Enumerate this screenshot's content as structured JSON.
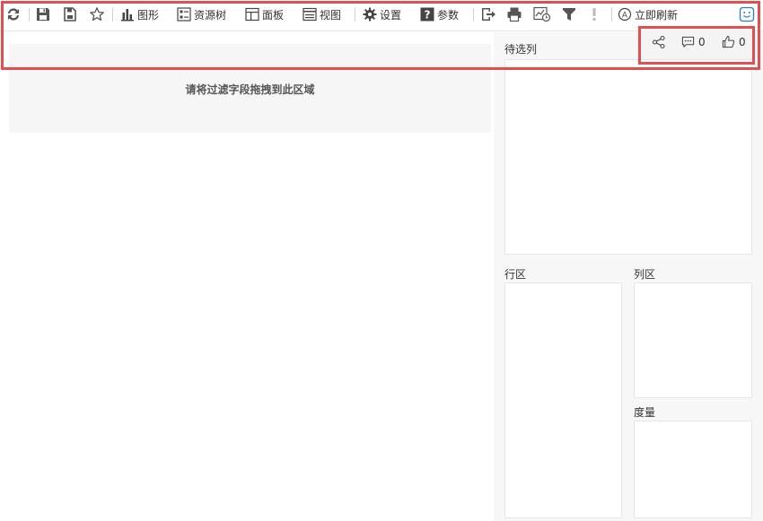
{
  "toolbar": {
    "chart_label": "图形",
    "resource_tree_label": "资源树",
    "panel_label": "面板",
    "view_label": "视图",
    "settings_label": "设置",
    "params_label": "参数",
    "refresh_now_label": "立即刷新"
  },
  "social": {
    "comment_count": "0",
    "like_count": "0"
  },
  "filter_area": {
    "placeholder": "请将过滤字段拖拽到此区域"
  },
  "right_panel": {
    "candidates_label": "待选列",
    "rows_label": "行区",
    "columns_label": "列区",
    "measures_label": "度量"
  },
  "colors": {
    "highlight_border": "#e05050",
    "panel_bg": "#f7f7f7",
    "accent": "#2a7ad6"
  }
}
